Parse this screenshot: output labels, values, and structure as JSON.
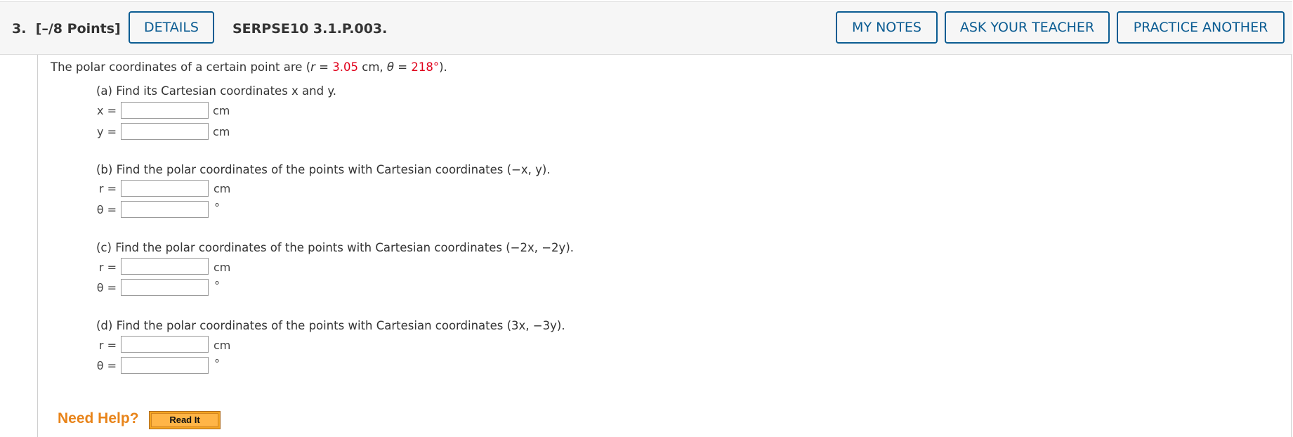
{
  "header": {
    "question_number": "3.",
    "points": "[–/8 Points]",
    "details_label": "DETAILS",
    "problem_code": "SERPSE10 3.1.P.003.",
    "my_notes_label": "MY NOTES",
    "ask_teacher_label": "ASK YOUR TEACHER",
    "practice_another_label": "PRACTICE ANOTHER"
  },
  "problem": {
    "intro_prefix": "The polar coordinates of a certain point are (",
    "r_symbol": "r",
    "eq1": " = ",
    "r_value": "3.05",
    "r_unit": " cm, ",
    "theta_symbol": "θ",
    "eq2": " = ",
    "theta_value": "218°",
    "intro_suffix": ").",
    "parts": [
      {
        "prompt": "(a) Find its Cartesian coordinates x and y.",
        "fields": [
          {
            "label": "x =",
            "value": "",
            "unit": "cm"
          },
          {
            "label": "y =",
            "value": "",
            "unit": "cm"
          }
        ]
      },
      {
        "prompt": "(b) Find the polar coordinates of the points with Cartesian coordinates (−x, y).",
        "fields": [
          {
            "label": "r =",
            "value": "",
            "unit": "cm"
          },
          {
            "label": "θ =",
            "value": "",
            "unit": "°"
          }
        ]
      },
      {
        "prompt": "(c) Find the polar coordinates of the points with Cartesian coordinates (−2x, −2y).",
        "fields": [
          {
            "label": "r =",
            "value": "",
            "unit": "cm"
          },
          {
            "label": "θ =",
            "value": "",
            "unit": "°"
          }
        ]
      },
      {
        "prompt": "(d) Find the polar coordinates of the points with Cartesian coordinates (3x, −3y).",
        "fields": [
          {
            "label": "r =",
            "value": "",
            "unit": "cm"
          },
          {
            "label": "θ =",
            "value": "",
            "unit": "°"
          }
        ]
      }
    ]
  },
  "help": {
    "need_help_label": "Need Help?",
    "read_it_label": "Read It"
  }
}
